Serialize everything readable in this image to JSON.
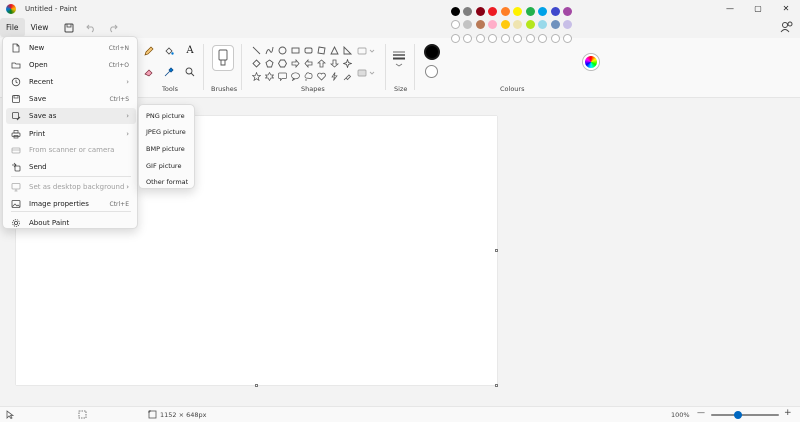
{
  "window": {
    "title": "Untitled - Paint",
    "minimize_icon": "—",
    "maximize_icon": "▢",
    "close_icon": "✕"
  },
  "menubar": {
    "file_label": "File",
    "view_label": "View"
  },
  "ribbon": {
    "groups": {
      "tools": "Tools",
      "brushes": "Brushes",
      "shapes": "Shapes",
      "size": "Size",
      "colours": "Colours"
    },
    "text_tool_glyph": "A",
    "colours": {
      "color1": "#000000",
      "row1": [
        "#000000",
        "#7f7f7f",
        "#880015",
        "#ed1c24",
        "#ff7f27",
        "#fff200",
        "#22b14c",
        "#00a2e8",
        "#3f48cc",
        "#a349a4"
      ],
      "row2": [
        "#ffffff",
        "#c3c3c3",
        "#b97a57",
        "#ffaec9",
        "#ffc90e",
        "#efe4b0",
        "#b5e61d",
        "#99d9ea",
        "#7092be",
        "#c8bfe7"
      ],
      "row3_empty": 10
    }
  },
  "file_menu": {
    "items": [
      {
        "label": "New",
        "shortcut": "Ctrl+N",
        "icon": "new-file-icon"
      },
      {
        "label": "Open",
        "shortcut": "Ctrl+O",
        "icon": "open-folder-icon"
      },
      {
        "label": "Recent",
        "arrow": "›",
        "icon": "clock-icon"
      },
      {
        "label": "Save",
        "shortcut": "Ctrl+S",
        "icon": "save-icon"
      },
      {
        "label": "Save as",
        "arrow": "›",
        "icon": "save-as-icon"
      },
      {
        "label": "Print",
        "arrow": "›",
        "icon": "print-icon"
      },
      {
        "label": "From scanner or camera",
        "icon": "scanner-icon"
      },
      {
        "label": "Send",
        "icon": "send-icon"
      },
      {
        "label": "Set as desktop background",
        "arrow": "›",
        "icon": "desktop-icon"
      },
      {
        "label": "Image properties",
        "shortcut": "Ctrl+E",
        "icon": "image-properties-icon"
      },
      {
        "label": "About Paint",
        "icon": "gear-icon"
      }
    ]
  },
  "save_as_submenu": {
    "items": [
      "PNG picture",
      "JPEG picture",
      "BMP picture",
      "GIF picture",
      "Other format"
    ]
  },
  "status": {
    "canvas_size": "1152 × 648px",
    "zoom": "100%",
    "zoom_out": "—",
    "zoom_in": "+"
  }
}
